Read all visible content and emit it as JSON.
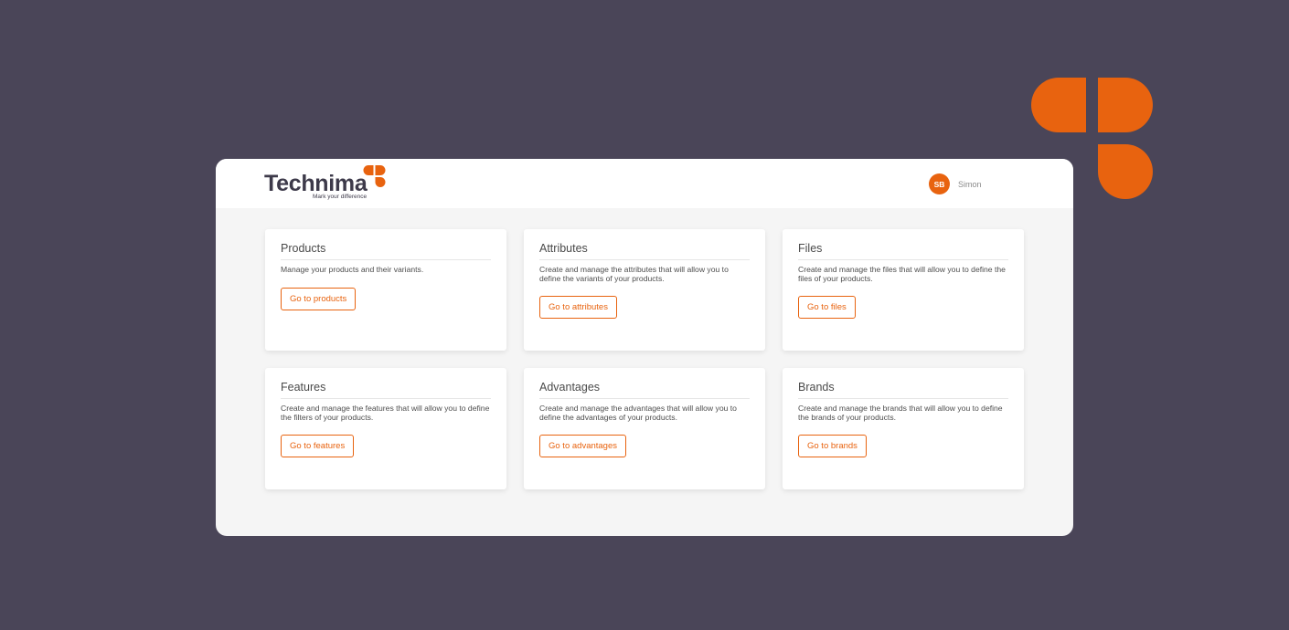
{
  "brand": {
    "name": "Technima",
    "tagline": "Mark your difference",
    "accent_color": "#e8630f",
    "logo_icon": "clover-icon"
  },
  "user": {
    "initials": "SB",
    "name": "Simon"
  },
  "cards": [
    {
      "title": "Products",
      "description": "Manage your products and their variants.",
      "button": "Go to products"
    },
    {
      "title": "Attributes",
      "description": "Create and manage the attributes that will allow you to define the variants of your products.",
      "button": "Go to attributes"
    },
    {
      "title": "Files",
      "description": "Create and manage the files that will allow you to define the files of your products.",
      "button": "Go to files"
    },
    {
      "title": "Features",
      "description": "Create and manage the features that will allow you to define the filters of your products.",
      "button": "Go to features"
    },
    {
      "title": "Advantages",
      "description": "Create and manage the advantages that will allow you to define the advantages of your products.",
      "button": "Go to advantages"
    },
    {
      "title": "Brands",
      "description": "Create and manage the brands that will allow you to define the brands of your products.",
      "button": "Go to brands"
    }
  ]
}
